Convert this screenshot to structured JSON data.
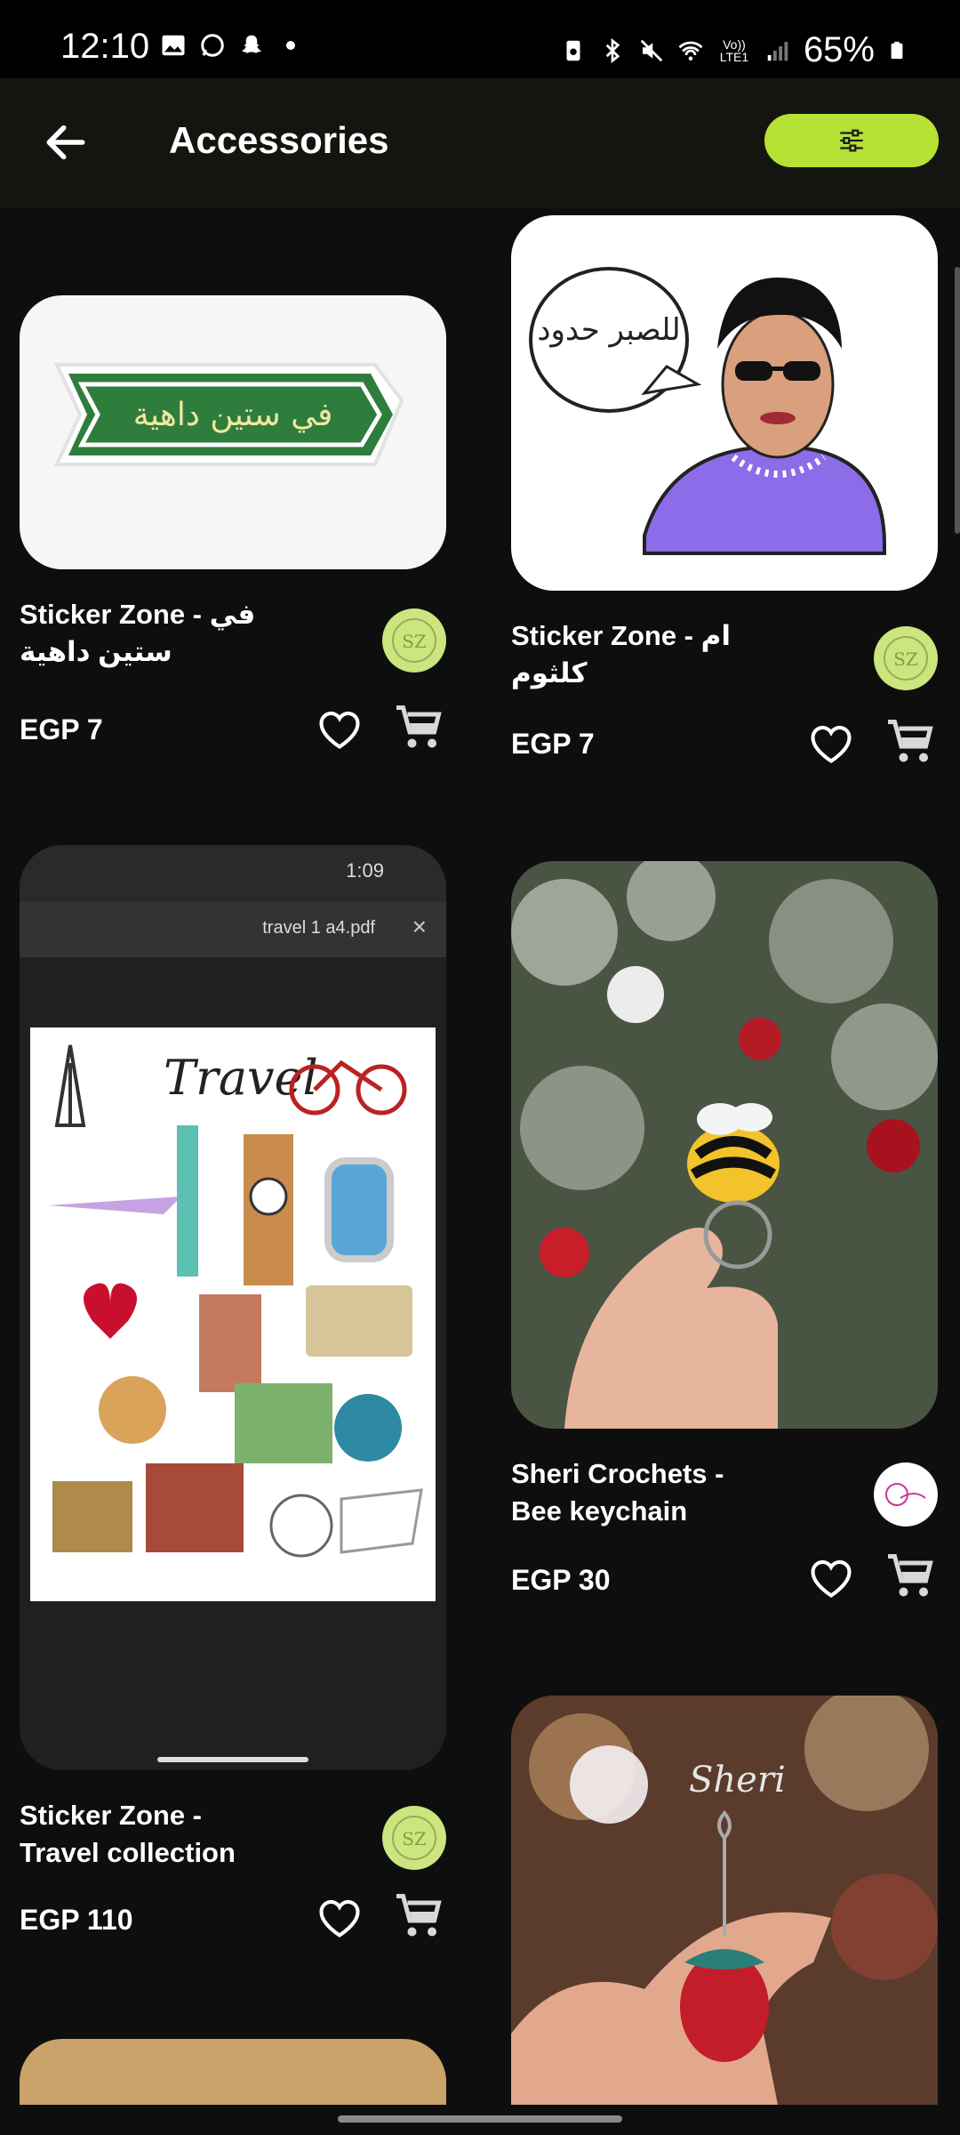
{
  "status": {
    "time": "12:10",
    "battery": "65%",
    "network_label": "Vo)) LTE1"
  },
  "header": {
    "title": "Accessories",
    "back_icon": "arrow-left-icon",
    "filter_icon": "sliders-icon",
    "accent_color": "#b6e135"
  },
  "products": [
    {
      "name": "Sticker Zone - في ستين داهية",
      "price": "EGP 7",
      "image_text": "في ستين داهية",
      "seller": "Sticker Zone"
    },
    {
      "name": "Sticker Zone - ام كلثوم",
      "price": "EGP 7",
      "image_text": "للصبر حدود",
      "seller": "Sticker Zone"
    },
    {
      "name": "Sticker Zone - Travel collection",
      "price": "EGP 110",
      "image_text": "Travel",
      "seller": "Sticker Zone"
    },
    {
      "name": "Sheri Crochets - Bee keychain",
      "price": "EGP 30",
      "image_text": "",
      "seller": "Sheri Crochets"
    },
    {
      "name": "",
      "price": "",
      "image_text": "Sheri",
      "seller": "Sheri Crochets"
    }
  ],
  "pdf_preview": {
    "time": "1:09",
    "filename": "travel 1 a4.pdf"
  }
}
